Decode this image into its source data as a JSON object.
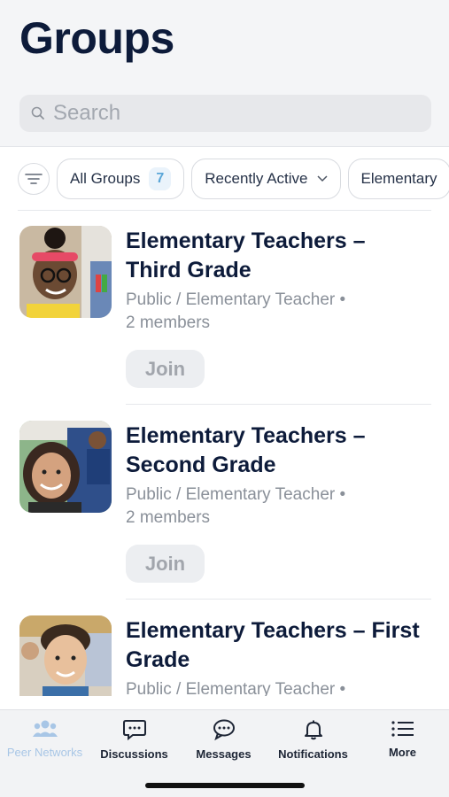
{
  "header": {
    "title": "Groups"
  },
  "search": {
    "placeholder": "Search",
    "icon": "search-icon"
  },
  "filters": {
    "chips": [
      {
        "label": "All Groups",
        "count": "7"
      },
      {
        "label": "Recently Active"
      },
      {
        "label": "Elementary"
      }
    ]
  },
  "groups": [
    {
      "title_line1": "Elementary Teachers –",
      "title_line2": "Third Grade",
      "meta_line1": "Public / Elementary Teacher  •",
      "meta_line2": "2 members",
      "join_label": "Join"
    },
    {
      "title_line1": "Elementary Teachers –",
      "title_line2": "Second Grade",
      "meta_line1": "Public / Elementary Teacher  •",
      "meta_line2": "2 members",
      "join_label": "Join"
    },
    {
      "title_line1": "Elementary Teachers – First",
      "title_line2": "Grade",
      "meta_line1": "Public / Elementary Teacher  •",
      "meta_line2": "",
      "join_label": ""
    }
  ],
  "tabbar": {
    "tabs": [
      {
        "label": "Peer Networks",
        "icon": "people-icon",
        "active": true
      },
      {
        "label": "Discussions",
        "icon": "chat-bubble-icon"
      },
      {
        "label": "Messages",
        "icon": "message-bubble-icon"
      },
      {
        "label": "Notifications",
        "icon": "bell-icon"
      },
      {
        "label": "More",
        "icon": "menu-icon"
      }
    ]
  },
  "colors": {
    "accent": "#5aa6d8",
    "title": "#0d1b3a",
    "active_tab": "#a8c6e6"
  }
}
